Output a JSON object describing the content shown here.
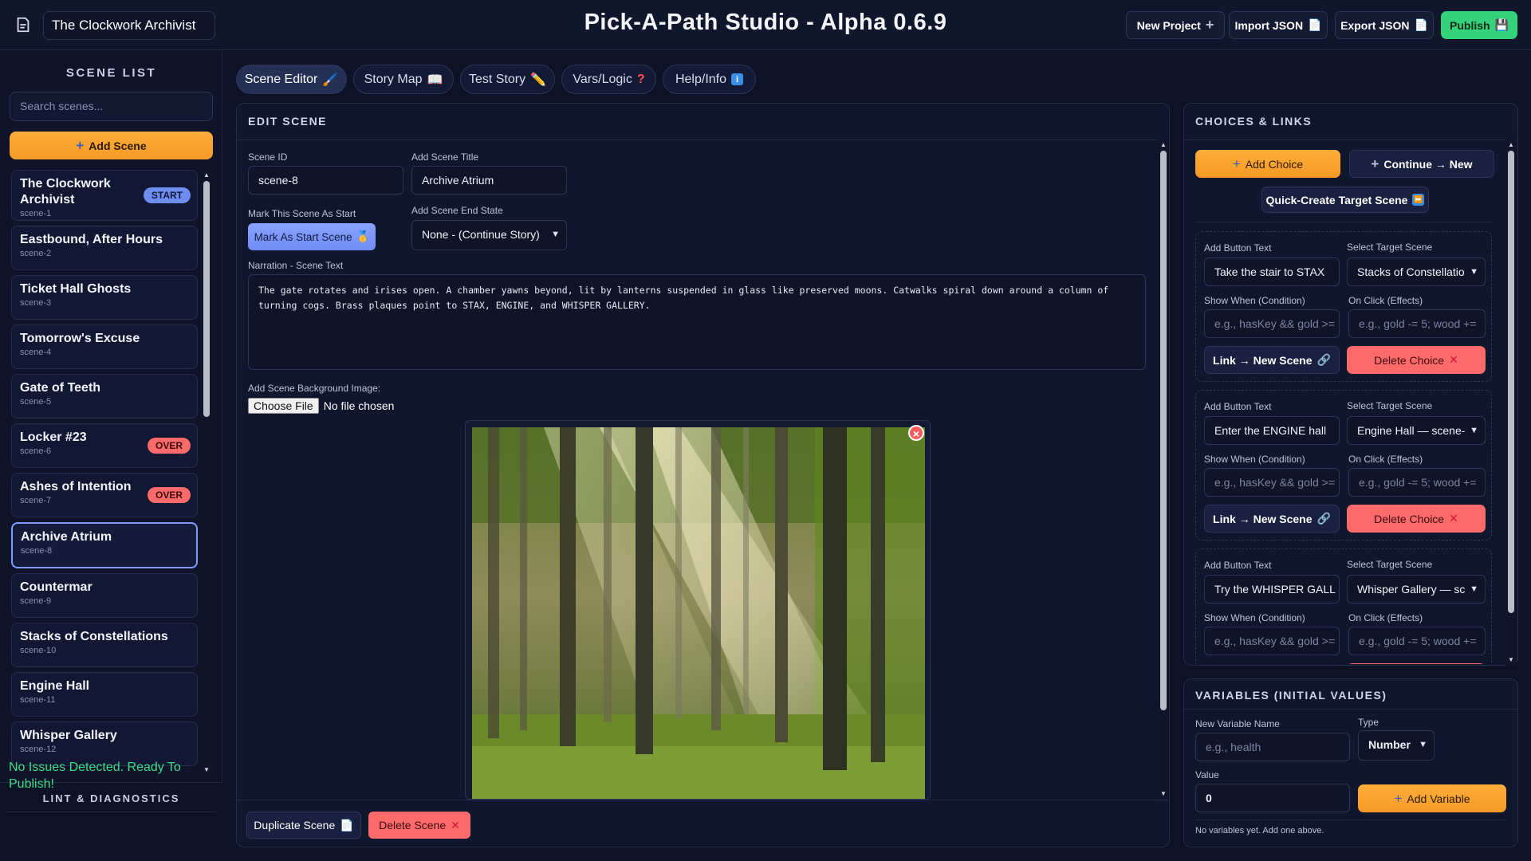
{
  "header": {
    "project_name": "The Clockwork Archivist",
    "app_title": "Pick-A-Path Studio - Alpha 0.6.9",
    "buttons": {
      "new_project": "New Project",
      "import_json": "Import JSON",
      "export_json": "Export JSON",
      "publish": "Publish"
    }
  },
  "sidebar": {
    "title": "SCENE LIST",
    "search_placeholder": "Search scenes...",
    "add_scene": "Add Scene",
    "scenes": [
      {
        "name": "The Clockwork Archivist",
        "id": "scene-1",
        "badge": "START"
      },
      {
        "name": "Eastbound, After Hours",
        "id": "scene-2"
      },
      {
        "name": "Ticket Hall Ghosts",
        "id": "scene-3"
      },
      {
        "name": "Tomorrow's Excuse",
        "id": "scene-4"
      },
      {
        "name": "Gate of Teeth",
        "id": "scene-5"
      },
      {
        "name": "Locker #23",
        "id": "scene-6",
        "badge": "OVER"
      },
      {
        "name": "Ashes of Intention",
        "id": "scene-7",
        "badge": "OVER"
      },
      {
        "name": "Archive Atrium",
        "id": "scene-8",
        "selected": true
      },
      {
        "name": "Countermar",
        "id": "scene-9"
      },
      {
        "name": "Stacks of Constellations",
        "id": "scene-10"
      },
      {
        "name": "Engine Hall",
        "id": "scene-11"
      },
      {
        "name": "Whisper Gallery",
        "id": "scene-12"
      }
    ],
    "lint_title": "LINT & DIAGNOSTICS",
    "lint_message": "No Issues Detected. Ready To Publish!"
  },
  "tabs": [
    {
      "label": "Scene Editor",
      "icon": "brush-icon",
      "active": true
    },
    {
      "label": "Story Map",
      "icon": "book-icon"
    },
    {
      "label": "Test Story",
      "icon": "pencil-icon"
    },
    {
      "label": "Vars/Logic",
      "icon": "question-icon"
    },
    {
      "label": "Help/Info",
      "icon": "info-icon"
    }
  ],
  "editor": {
    "title": "EDIT SCENE",
    "scene_id_label": "Scene ID",
    "scene_id": "scene-8",
    "scene_title_label": "Add Scene Title",
    "scene_title": "Archive Atrium",
    "start_label": "Mark This Scene As Start",
    "start_button": "Mark As Start Scene",
    "end_state_label": "Add Scene End State",
    "end_state": "None - (Continue Story)",
    "narration_label": "Narration - Scene Text",
    "narration": "The gate rotates and irises open. A chamber yawns beyond, lit by lanterns suspended in glass like preserved moons. Catwalks spiral down around a column of turning cogs. Brass plaques point to STAX, ENGINE, and WHISPER GALLERY.",
    "bg_label": "Add Scene Background Image:",
    "file_button": "Choose File",
    "file_status": "No file chosen",
    "duplicate": "Duplicate Scene",
    "delete": "Delete Scene"
  },
  "choices": {
    "title": "CHOICES & LINKS",
    "add_choice": "Add Choice",
    "continue_new": "Continue → New",
    "quick_create": "Quick-Create Target Scene",
    "labels": {
      "button_text": "Add Button Text",
      "target": "Select Target Scene",
      "condition": "Show When (Condition)",
      "effects": "On Click (Effects)",
      "condition_placeholder": "e.g., hasKey && gold >=",
      "effects_placeholder": "e.g., gold -= 5; wood +=",
      "link_new": "Link → New Scene",
      "delete_choice": "Delete Choice"
    },
    "items": [
      {
        "text": "Take the stair to STAX",
        "target": "Stacks of Constellatio"
      },
      {
        "text": "Enter the ENGINE hall",
        "target": "Engine Hall — scene-"
      },
      {
        "text": "Try the WHISPER GALL",
        "target": "Whisper Gallery — sc"
      }
    ]
  },
  "variables": {
    "title": "VARIABLES (INITIAL VALUES)",
    "name_label": "New Variable Name",
    "name_placeholder": "e.g., health",
    "type_label": "Type",
    "type": "Number",
    "value_label": "Value",
    "value": "0",
    "add": "Add Variable",
    "empty": "No variables yet. Add one above."
  },
  "colors": {
    "accent_orange": "#f59a24",
    "accent_blue": "#6f8bf5",
    "danger": "#ff6b6b",
    "success": "#34d27b"
  }
}
